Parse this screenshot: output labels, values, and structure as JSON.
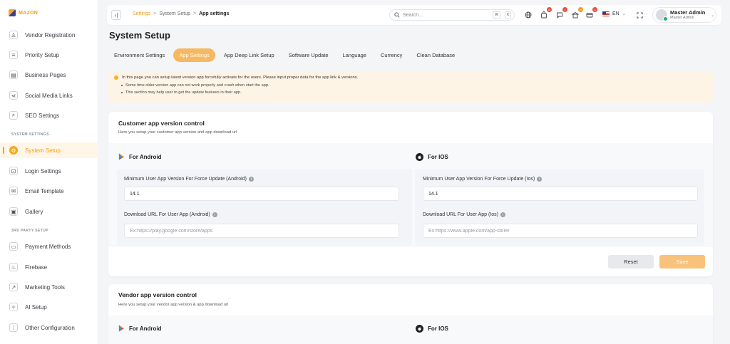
{
  "brand": {
    "name": "MAZON"
  },
  "sidebar": {
    "items_top": [
      {
        "label": "Vendor Registration",
        "icon": "user-plus-icon",
        "glyph": "♙"
      },
      {
        "label": "Priority Setup",
        "icon": "sliders-icon",
        "glyph": "≡"
      },
      {
        "label": "Business Pages",
        "icon": "page-icon",
        "glyph": "▤"
      },
      {
        "label": "Social Media Links",
        "icon": "share-icon",
        "glyph": "⋖"
      },
      {
        "label": "SEO Settings",
        "icon": "search-icon",
        "glyph": "⌕"
      }
    ],
    "section_system": "SYSTEM SETTINGS",
    "items_system": [
      {
        "label": "System Setup",
        "icon": "gear-icon",
        "glyph": "⚙",
        "active": true
      },
      {
        "label": "Login Settings",
        "icon": "lock-icon",
        "glyph": "⊡"
      },
      {
        "label": "Email Template",
        "icon": "mail-icon",
        "glyph": "✉"
      },
      {
        "label": "Gallery",
        "icon": "gallery-icon",
        "glyph": "▣"
      }
    ],
    "section_third": "3RD PARTY SETUP",
    "items_third": [
      {
        "label": "Payment Methods",
        "icon": "card-icon",
        "glyph": "▭"
      },
      {
        "label": "Firebase",
        "icon": "flame-icon",
        "glyph": "♨"
      },
      {
        "label": "Marketing Tools",
        "icon": "chart-icon",
        "glyph": "↗"
      },
      {
        "label": "AI Setup",
        "icon": "sparkle-icon",
        "glyph": "✧"
      },
      {
        "label": "Other Configuration",
        "icon": "grid-icon",
        "glyph": "⁞"
      }
    ]
  },
  "topbar": {
    "breadcrumb": {
      "root": "Settings",
      "mid": "System Setup",
      "current": "App settings",
      "sep": ">"
    },
    "search": {
      "placeholder": "Search...",
      "shortcut_mod": "⌘",
      "shortcut_key": "K"
    },
    "badges": {
      "orders": "8",
      "messages": "1",
      "shop": "5",
      "cards": "4"
    },
    "language": "EN",
    "user": {
      "name": "Master Admin",
      "role": "Master Admin"
    }
  },
  "page": {
    "title": "System Setup"
  },
  "tabs": [
    {
      "label": "Environment Settings",
      "active": false
    },
    {
      "label": "App Settings",
      "active": true
    },
    {
      "label": "App Deep Link Setup",
      "active": false
    },
    {
      "label": "Software Update",
      "active": false
    },
    {
      "label": "Language",
      "active": false
    },
    {
      "label": "Currency",
      "active": false
    },
    {
      "label": "Clean Database",
      "active": false
    }
  ],
  "notice": {
    "main": "In this page you can setup latest version app forcefully activate for the users. Please input proper data for the app link & versions.",
    "points": [
      "Some time older version app can not work properly and crash when start the app.",
      "This section may help user to get the update features in their app."
    ]
  },
  "customer": {
    "title": "Customer app version control",
    "subtitle": "Here you setup your customer app version and app download url",
    "android": {
      "heading": "For Android",
      "min_label": "Minimum User App Version For Force Update (Android)",
      "min_value": "14.1",
      "url_label": "Download URL For User App (Android)",
      "url_placeholder": "Ex:https://play.google.com/store/apps"
    },
    "ios": {
      "heading": "For IOS",
      "min_label": "Minimum User App Version For Force Update (Ios)",
      "min_value": "14.1",
      "url_label": "Download URL For User App (Ios)",
      "url_placeholder": "Ex:https://www.apple.com/app-store/"
    },
    "reset_label": "Reset",
    "save_label": "Save"
  },
  "vendor": {
    "title": "Vendor app version control",
    "subtitle": "Here you setup your vendor app version & app download url",
    "android_heading": "For Android",
    "ios_heading": "For IOS"
  },
  "colors": {
    "accent": "#f6a623",
    "notice_bg": "#fdf4e6",
    "save_bg": "#f8c27a"
  }
}
